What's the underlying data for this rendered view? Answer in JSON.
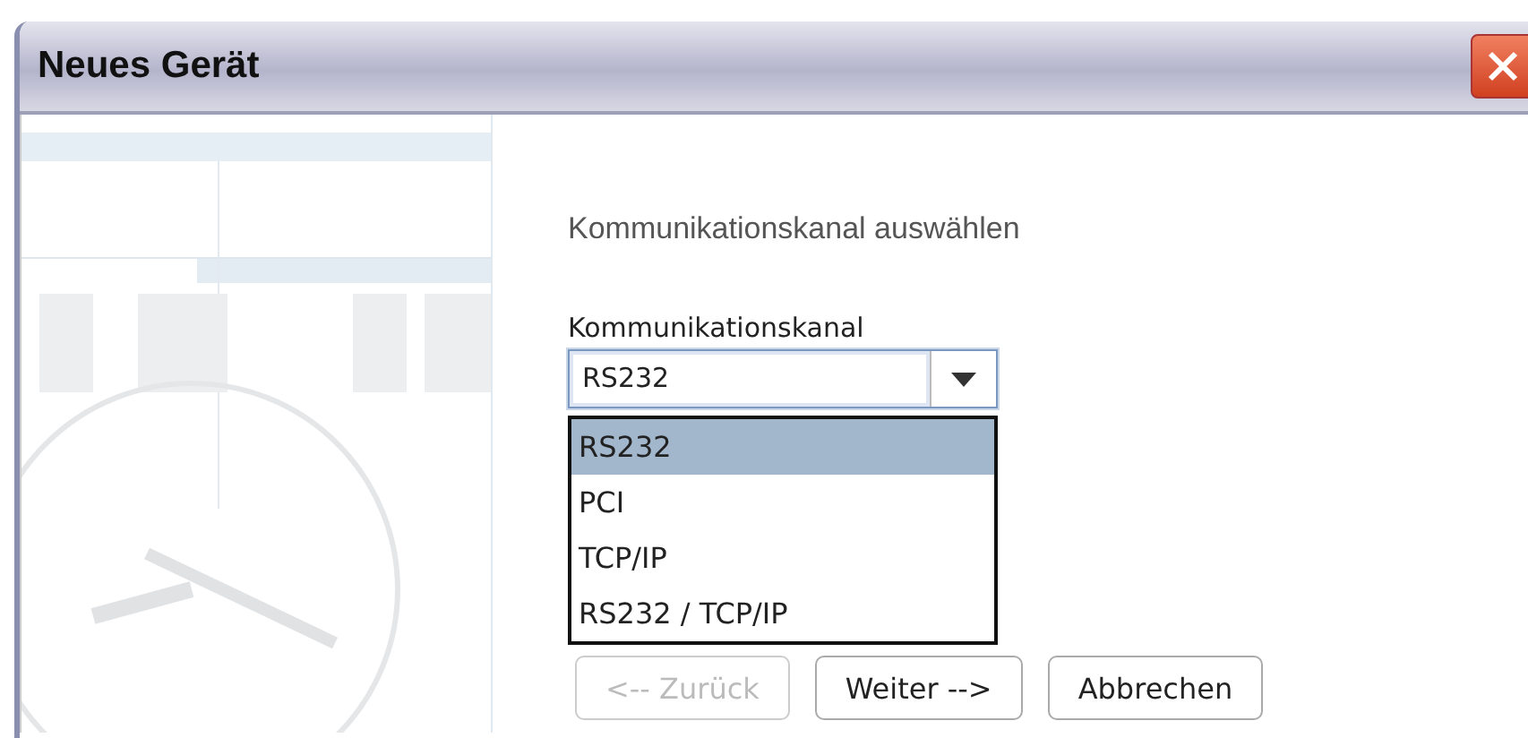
{
  "window": {
    "title": "Neues Gerät"
  },
  "heading": "Kommunikationskanal auswählen",
  "combo": {
    "label": "Kommunikationskanal",
    "value": "RS232",
    "expanded": true,
    "options": [
      {
        "label": "RS232",
        "selected": true
      },
      {
        "label": "PCI",
        "selected": false
      },
      {
        "label": "TCP/IP",
        "selected": false
      },
      {
        "label": "RS232 / TCP/IP",
        "selected": false
      }
    ]
  },
  "buttons": [
    {
      "label": "<-- Zurück",
      "disabled": true
    },
    {
      "label": "Weiter -->",
      "disabled": false
    },
    {
      "label": "Abbrechen",
      "disabled": false
    }
  ]
}
